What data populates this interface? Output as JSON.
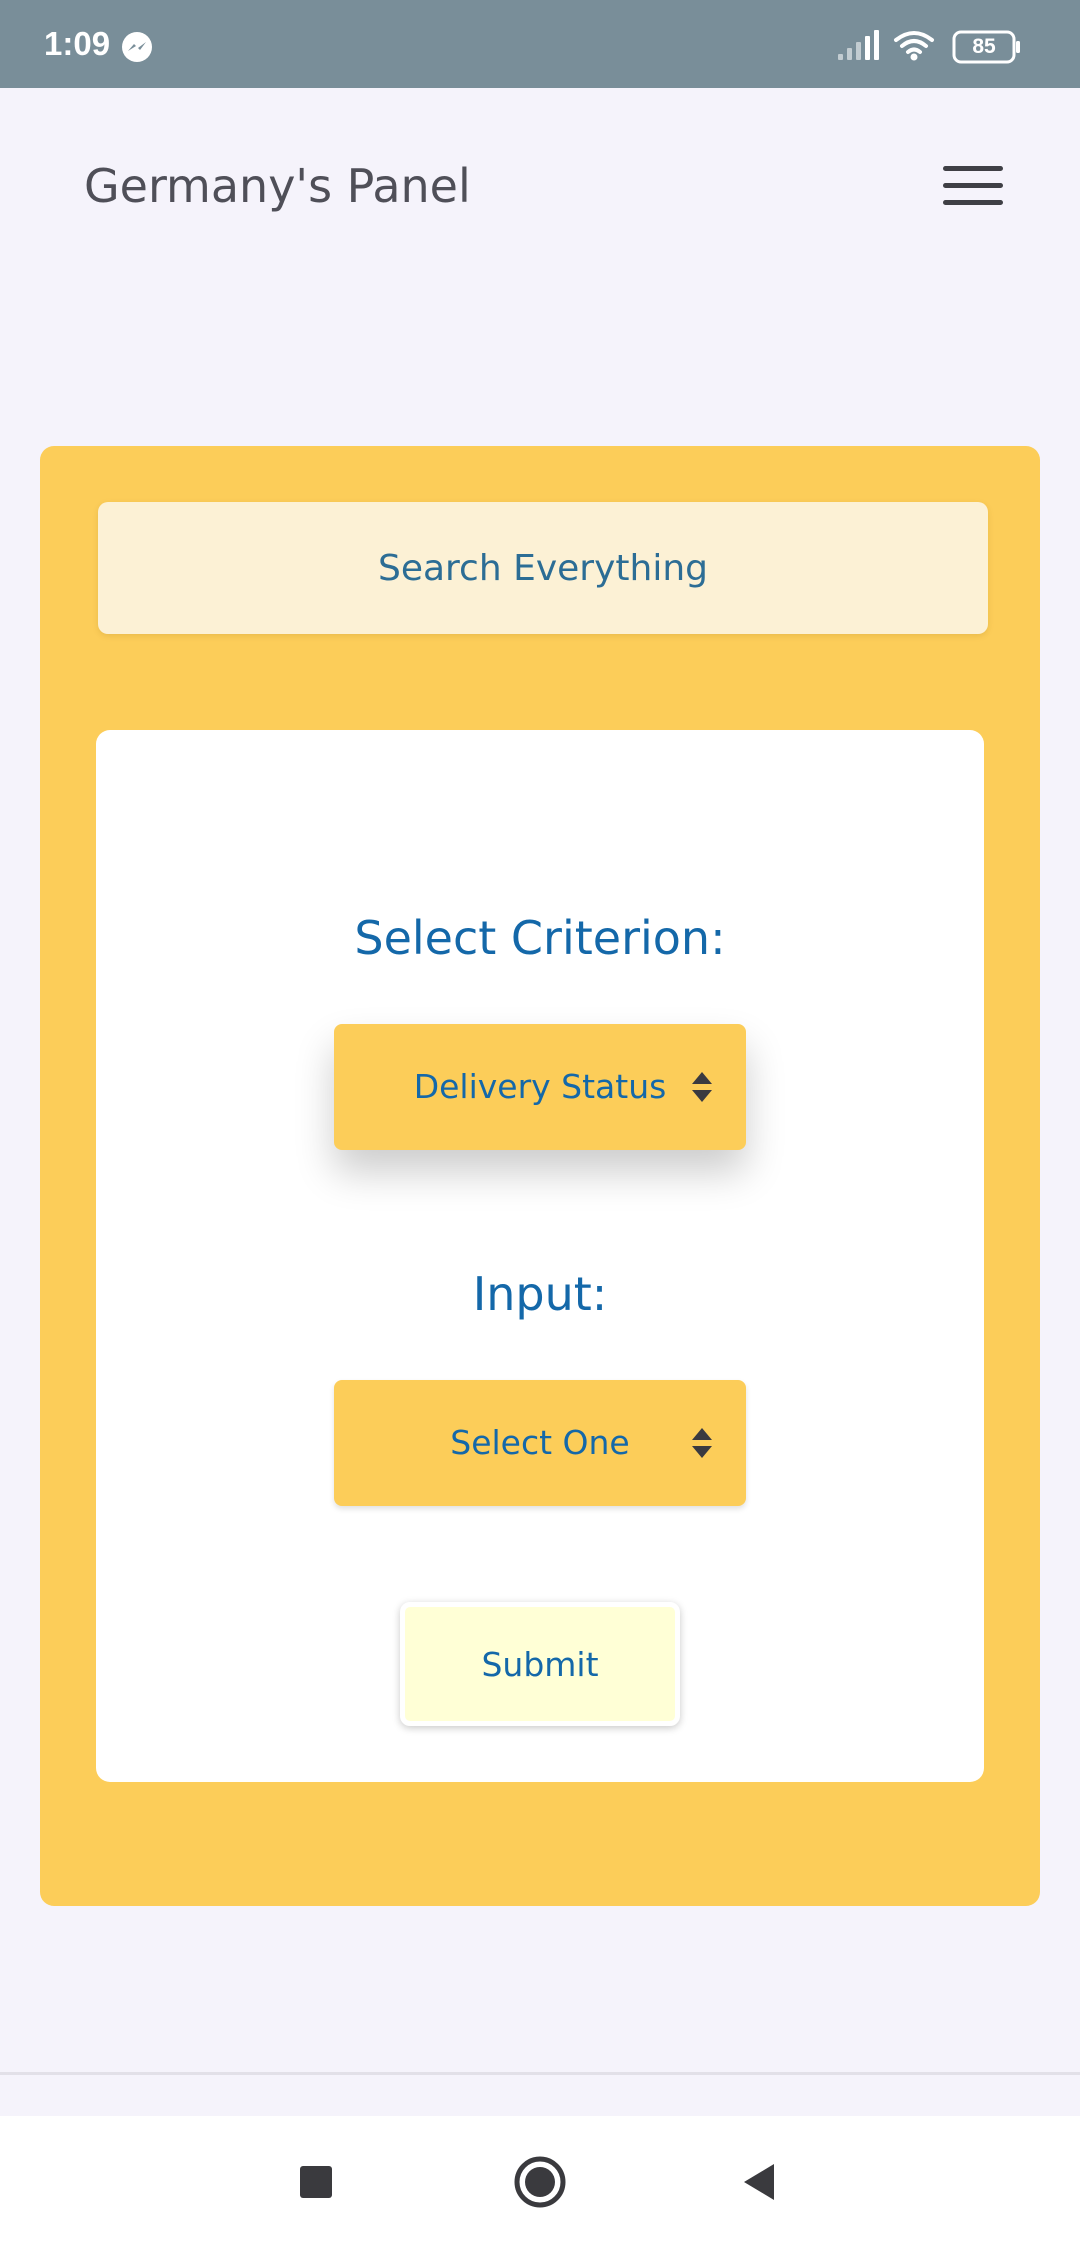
{
  "status_bar": {
    "time": "1:09",
    "notification_icon": "messenger-icon",
    "signal_icon": "signal-icon",
    "wifi_icon": "wifi-icon",
    "battery_level": "85"
  },
  "header": {
    "title": "Germany's Panel",
    "menu_icon": "hamburger-menu-icon"
  },
  "search": {
    "placeholder": "Search Everything"
  },
  "form": {
    "criterion_label": "Select Criterion:",
    "criterion_value": "Delivery Status",
    "input_label": "Input:",
    "input_value": "Select One",
    "dropdown_icon": "sort-arrows-icon",
    "submit_label": "Submit"
  },
  "nav_bar": {
    "recents_icon": "square-recents-icon",
    "home_icon": "circle-home-icon",
    "back_icon": "triangle-back-icon"
  },
  "colors": {
    "status_bar": "#798e99",
    "background": "#f5f3fb",
    "panel": "#fccd59",
    "search_box": "#fcf1d5",
    "accent_text": "#1468a9",
    "submit_button": "#ffffd6"
  }
}
